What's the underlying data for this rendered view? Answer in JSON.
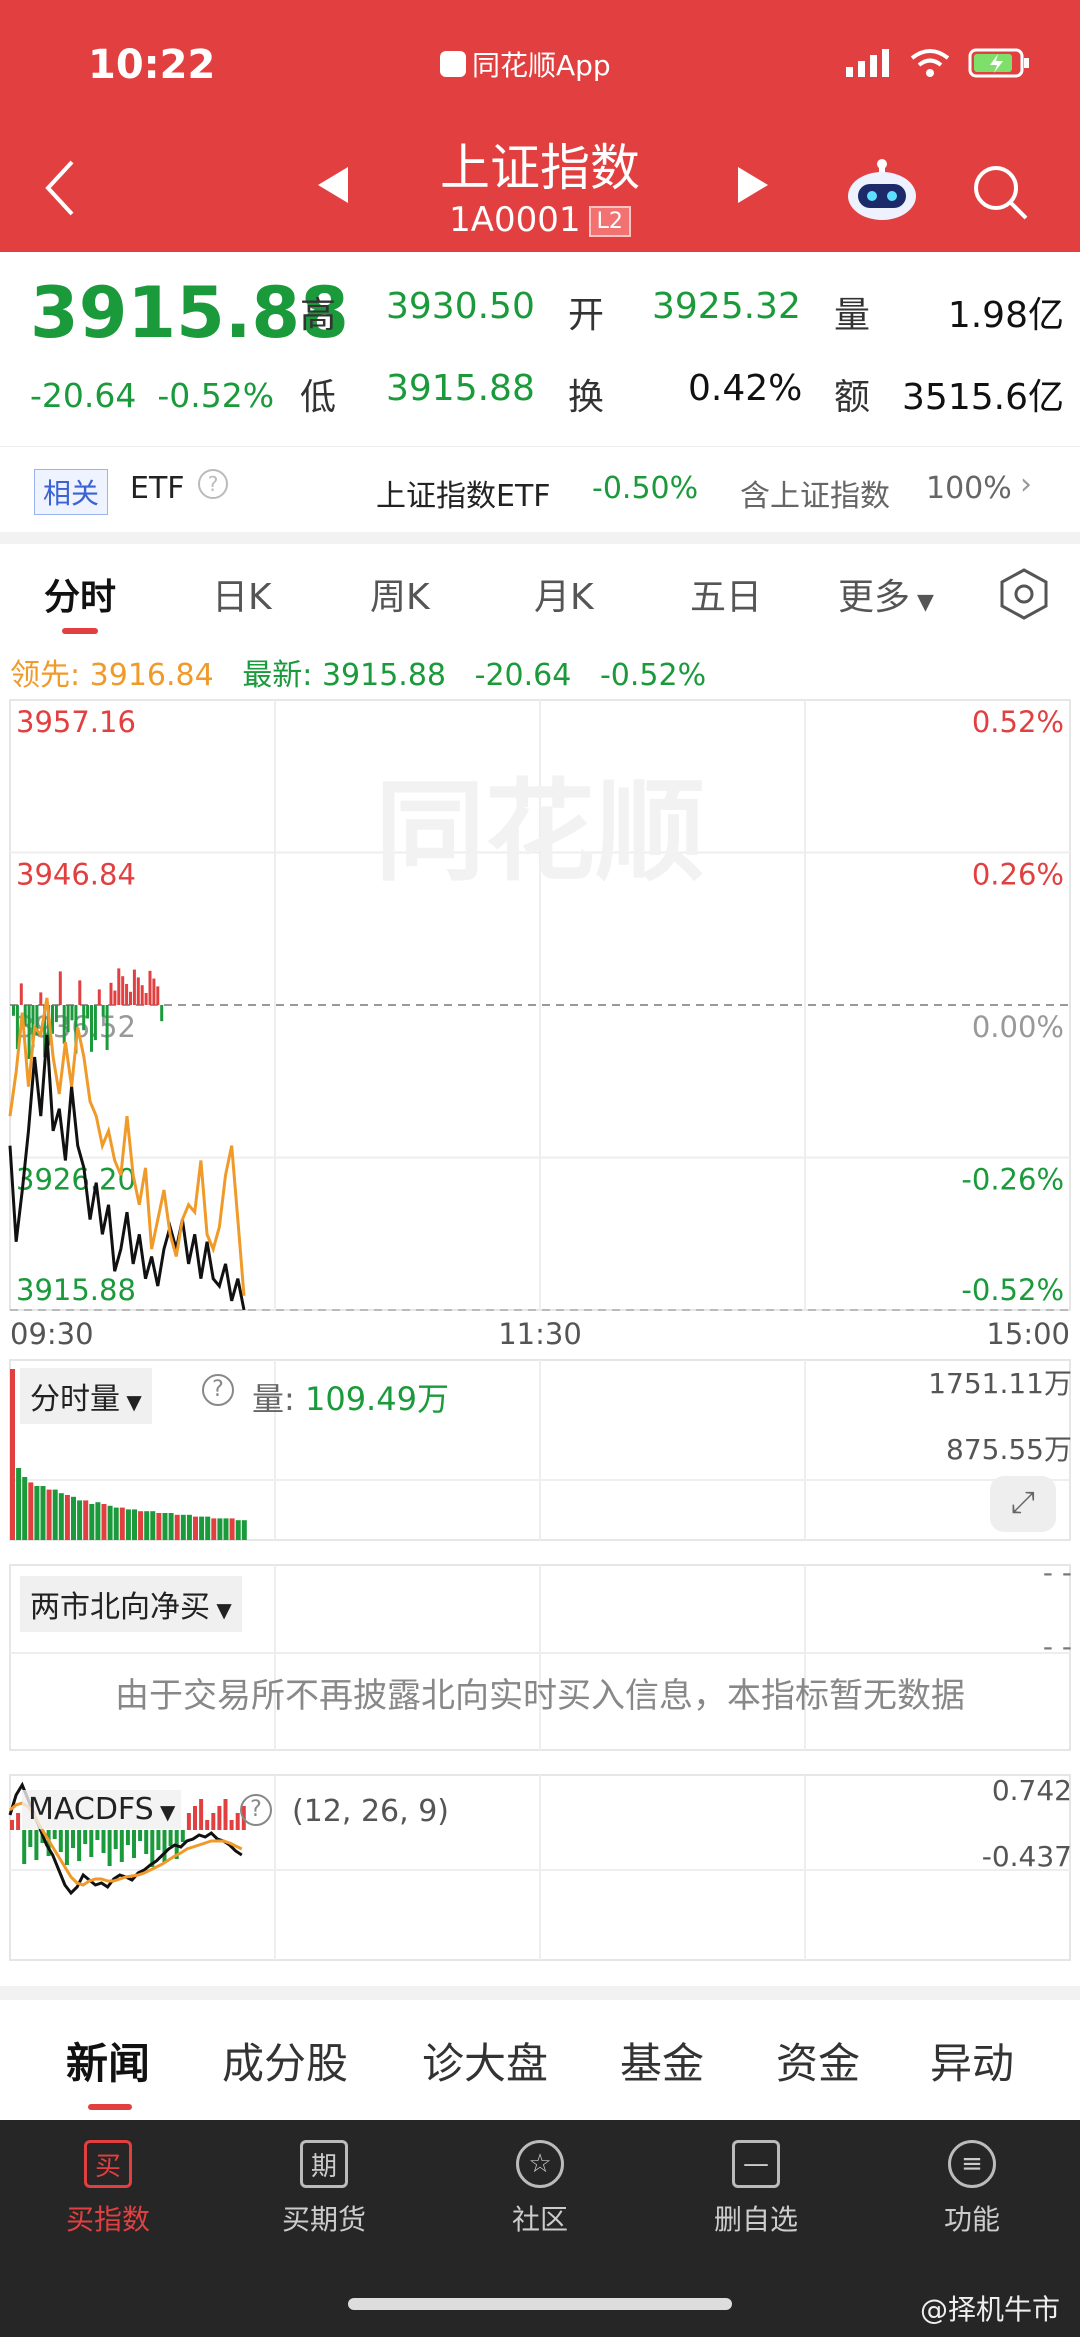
{
  "status": {
    "time": "10:22",
    "app": "同花顺App"
  },
  "header": {
    "title": "上证指数",
    "code": "1A0001",
    "level": "L2"
  },
  "quote": {
    "price": "3915.88",
    "change": "-20.64",
    "change_pct": "-0.52%",
    "high_label": "高",
    "high": "3930.50",
    "open_label": "开",
    "open": "3925.32",
    "vol_label": "量",
    "vol": "1.98亿",
    "low_label": "低",
    "low": "3915.88",
    "turn_label": "换",
    "turn": "0.42%",
    "amt_label": "额",
    "amt": "3515.6亿"
  },
  "related": {
    "tag": "相关",
    "etf": "ETF",
    "etf_name": "上证指数ETF",
    "etf_change": "-0.50%",
    "contains": "含上证指数",
    "contains_pct": "100%"
  },
  "tabs": [
    "分时",
    "日K",
    "周K",
    "月K",
    "五日",
    "更多"
  ],
  "info": {
    "lead": "领先: 3916.84",
    "latest": "最新: 3915.88",
    "chg": "-20.64",
    "pct": "-0.52%"
  },
  "chart_data": {
    "type": "line",
    "title": "",
    "x_ticks": [
      "09:30",
      "11:30",
      "15:00"
    ],
    "y_ticks_left": [
      "3957.16",
      "3946.84",
      "3936.52",
      "3926.20",
      "3915.88"
    ],
    "y_ticks_right": [
      "0.52%",
      "0.26%",
      "0.00%",
      "-0.26%",
      "-0.52%"
    ],
    "ylim": [
      3915.88,
      3957.16
    ],
    "watermark": "同花顺",
    "series": [
      {
        "color": "#111111",
        "values": [
          3927.0,
          3920.5,
          3924.0,
          3928.0,
          3933.0,
          3929.0,
          3934.5,
          3928.0,
          3929.5,
          3926.0,
          3931.0,
          3927.0,
          3925.5,
          3922.0,
          3924.5,
          3921.0,
          3923.0,
          3918.5,
          3920.0,
          3922.5,
          3919.0,
          3921.0,
          3918.0,
          3919.5,
          3917.5,
          3920.0,
          3921.5,
          3920.0,
          3922.0,
          3919.0,
          3921.0,
          3918.0,
          3920.5,
          3918.0,
          3917.5,
          3919.0,
          3916.5,
          3918.0,
          3915.88
        ]
      },
      {
        "color": "#f09a2a",
        "values": [
          3929.0,
          3932.0,
          3936.0,
          3931.0,
          3935.0,
          3934.5,
          3937.0,
          3933.0,
          3930.5,
          3934.0,
          3931.0,
          3935.0,
          3933.0,
          3930.0,
          3929.0,
          3927.0,
          3928.0,
          3926.0,
          3925.0,
          3929.0,
          3925.0,
          3923.0,
          3925.5,
          3920.0,
          3922.0,
          3924.0,
          3921.0,
          3919.5,
          3922.0,
          3923.0,
          3922.5,
          3926.0,
          3921.0,
          3920.0,
          3921.5,
          3925.0,
          3927.0,
          3922.0,
          3916.84
        ]
      }
    ]
  },
  "volume": {
    "label": "分时量",
    "value_label": "量:",
    "value": "109.49万",
    "max": "1751.11万",
    "mid": "875.55万",
    "bars": [
      0.95,
      0.4,
      0.35,
      0.32,
      0.3,
      0.3,
      0.28,
      0.28,
      0.26,
      0.25,
      0.24,
      0.22,
      0.22,
      0.2,
      0.21,
      0.2,
      0.19,
      0.18,
      0.18,
      0.17,
      0.17,
      0.16,
      0.16,
      0.16,
      0.15,
      0.15,
      0.15,
      0.14,
      0.14,
      0.14,
      0.13,
      0.13,
      0.13,
      0.12,
      0.12,
      0.12,
      0.12,
      0.11,
      0.11
    ]
  },
  "northbound": {
    "label": "两市北向净买",
    "notice": "由于交易所不再披露北向实时买入信息，本指标暂无数据",
    "dash1": "- -",
    "dash2": "- -"
  },
  "macd": {
    "label": "MACDFS",
    "params": "(12, 26, 9)",
    "max": "0.742",
    "min": "-0.437"
  },
  "news_tabs": [
    "新闻",
    "成分股",
    "诊大盘",
    "基金",
    "资金",
    "异动"
  ],
  "bottom_nav": [
    {
      "label": "买指数",
      "icon": "买"
    },
    {
      "label": "买期货",
      "icon": "期"
    },
    {
      "label": "社区",
      "icon": "☆"
    },
    {
      "label": "删自选",
      "icon": "—"
    },
    {
      "label": "功能",
      "icon": "≡"
    }
  ],
  "watermark": "@择机牛市",
  "colors": {
    "red": "#e24040",
    "green": "#1a9a3a",
    "orange": "#f09a2a"
  }
}
